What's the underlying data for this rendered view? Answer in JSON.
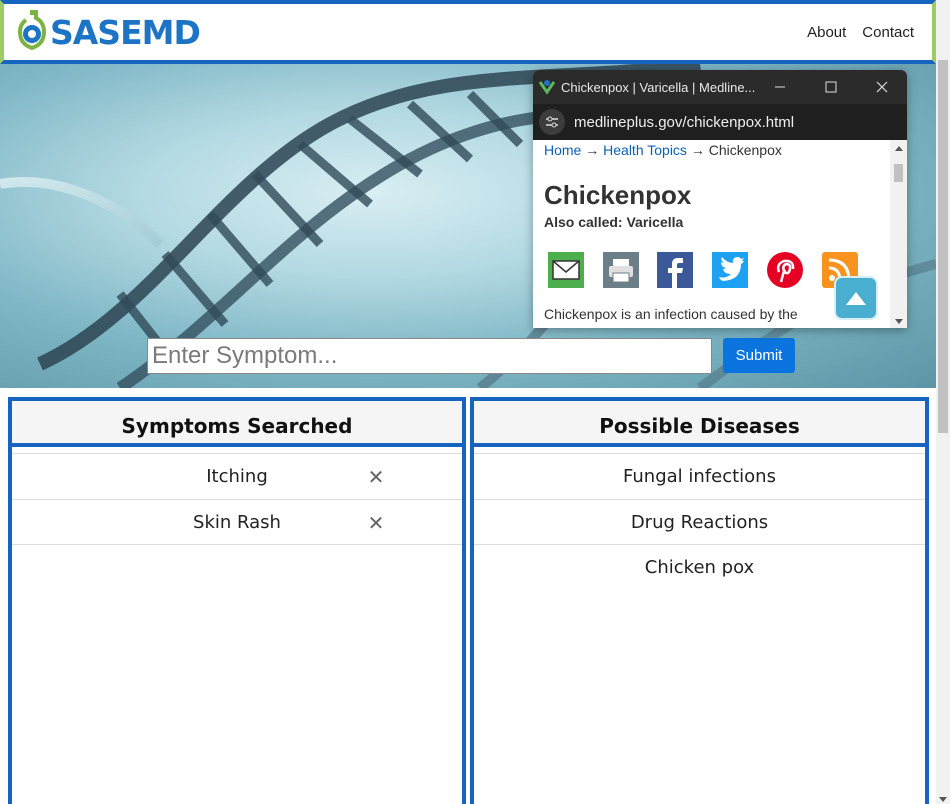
{
  "nav": {
    "brand": "SASEMD",
    "links": [
      "About",
      "Contact"
    ]
  },
  "search": {
    "placeholder": "Enter Symptom...",
    "submit_label": "Submit"
  },
  "symptoms_panel": {
    "title": "Symptoms Searched",
    "items": [
      "Itching",
      "Skin Rash"
    ],
    "remove_glyph": "✕"
  },
  "diseases_panel": {
    "title": "Possible Diseases",
    "items": [
      "Fungal infections",
      "Drug Reactions",
      "Chicken pox"
    ]
  },
  "popup": {
    "title": "Chickenpox | Varicella | Medline...",
    "url": "medlineplus.gov/chickenpox.html",
    "breadcrumb": [
      "Home",
      "Health Topics",
      "Chickenpox"
    ],
    "arrow": "→",
    "heading": "Chickenpox",
    "also_called": "Also called: Varicella",
    "intro": "Chickenpox is an infection caused by the",
    "share_icons": [
      "email-icon",
      "print-icon",
      "facebook-icon",
      "twitter-icon",
      "pinterest-icon",
      "rss-icon"
    ]
  },
  "colors": {
    "brand_blue": "#1565c0",
    "brand_green": "#9ccc65",
    "submit_blue": "#0b74de",
    "link_blue": "#0b61b1"
  }
}
